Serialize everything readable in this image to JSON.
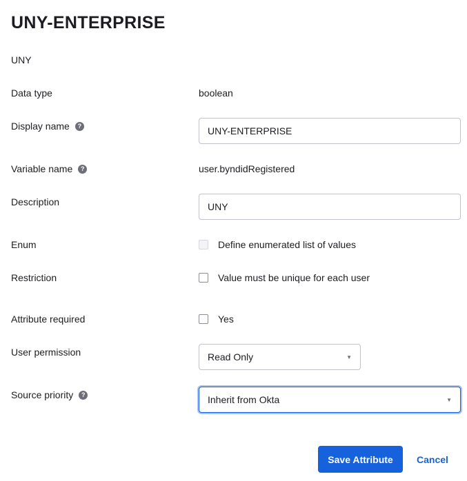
{
  "title": "UNY-ENTERPRISE",
  "subtitle": "UNY",
  "fields": {
    "data_type": {
      "label": "Data type",
      "value": "boolean"
    },
    "display_name": {
      "label": "Display name",
      "value": "UNY-ENTERPRISE"
    },
    "variable_name": {
      "label": "Variable name",
      "value": "user.byndidRegistered"
    },
    "description": {
      "label": "Description",
      "value": "UNY"
    },
    "enum": {
      "label": "Enum",
      "option": "Define enumerated list of values",
      "checked": false,
      "disabled": true
    },
    "restriction": {
      "label": "Restriction",
      "option": "Value must be unique for each user",
      "checked": false
    },
    "attribute_required": {
      "label": "Attribute required",
      "option": "Yes",
      "checked": false
    },
    "user_permission": {
      "label": "User permission",
      "selected": "Read Only"
    },
    "source_priority": {
      "label": "Source priority",
      "selected": "Inherit from Okta"
    }
  },
  "buttons": {
    "save": "Save Attribute",
    "cancel": "Cancel"
  },
  "icons": {
    "help": "help-icon",
    "caret": "caret-down-icon"
  },
  "colors": {
    "primary": "#1662dd",
    "text": "#1d1d21",
    "help_icon": "#6e6e78"
  }
}
